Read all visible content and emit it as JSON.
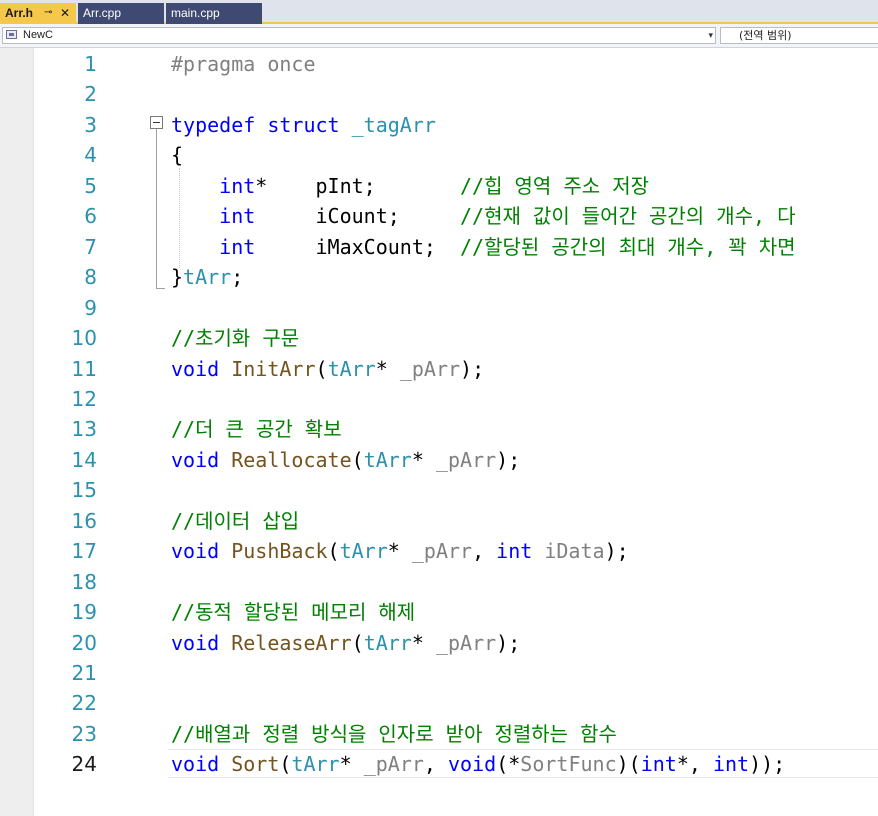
{
  "tabs": [
    {
      "label": "Arr.h",
      "pin": "⊸",
      "close": "✕"
    },
    {
      "label": "Arr.cpp"
    },
    {
      "label": "main.cpp"
    }
  ],
  "navbar": {
    "scope": "NewC",
    "member": "(전역 범위)",
    "dropdown_arrow": "▾"
  },
  "editor": {
    "current_line": 24,
    "lines": [
      {
        "n": "1",
        "tokens": [
          {
            "t": "#pragma once",
            "c": "pp"
          }
        ]
      },
      {
        "n": "2",
        "tokens": []
      },
      {
        "n": "3",
        "tokens": [
          {
            "t": "typedef",
            "c": "kw"
          },
          {
            "t": " "
          },
          {
            "t": "struct",
            "c": "kw"
          },
          {
            "t": " "
          },
          {
            "t": "_tagArr",
            "c": "ty"
          }
        ]
      },
      {
        "n": "4",
        "tokens": [
          {
            "t": "{"
          }
        ]
      },
      {
        "n": "5",
        "tokens": [
          {
            "t": "    "
          },
          {
            "t": "int",
            "c": "kw"
          },
          {
            "t": "*    pInt;       "
          },
          {
            "t": "//힙 영역 주소 저장",
            "c": "cm"
          }
        ]
      },
      {
        "n": "6",
        "tokens": [
          {
            "t": "    "
          },
          {
            "t": "int",
            "c": "kw"
          },
          {
            "t": "     iCount;     "
          },
          {
            "t": "//현재 값이 들어간 공간의 개수, 다",
            "c": "cm"
          }
        ]
      },
      {
        "n": "7",
        "tokens": [
          {
            "t": "    "
          },
          {
            "t": "int",
            "c": "kw"
          },
          {
            "t": "     iMaxCount;  "
          },
          {
            "t": "//할당된 공간의 최대 개수, 꽉 차면",
            "c": "cm"
          }
        ]
      },
      {
        "n": "8",
        "tokens": [
          {
            "t": "}"
          },
          {
            "t": "tArr",
            "c": "ty"
          },
          {
            "t": ";"
          }
        ]
      },
      {
        "n": "9",
        "tokens": []
      },
      {
        "n": "10",
        "tokens": [
          {
            "t": "//초기화 구문",
            "c": "cm"
          }
        ]
      },
      {
        "n": "11",
        "tokens": [
          {
            "t": "void",
            "c": "kw"
          },
          {
            "t": " "
          },
          {
            "t": "InitArr",
            "c": "fn"
          },
          {
            "t": "("
          },
          {
            "t": "tArr",
            "c": "ty"
          },
          {
            "t": "* "
          },
          {
            "t": "_pArr",
            "c": "pm"
          },
          {
            "t": ");"
          }
        ]
      },
      {
        "n": "12",
        "tokens": []
      },
      {
        "n": "13",
        "tokens": [
          {
            "t": "//더 큰 공간 확보",
            "c": "cm"
          }
        ]
      },
      {
        "n": "14",
        "tokens": [
          {
            "t": "void",
            "c": "kw"
          },
          {
            "t": " "
          },
          {
            "t": "Reallocate",
            "c": "fn"
          },
          {
            "t": "("
          },
          {
            "t": "tArr",
            "c": "ty"
          },
          {
            "t": "* "
          },
          {
            "t": "_pArr",
            "c": "pm"
          },
          {
            "t": ");"
          }
        ]
      },
      {
        "n": "15",
        "tokens": []
      },
      {
        "n": "16",
        "tokens": [
          {
            "t": "//데이터 삽입",
            "c": "cm"
          }
        ]
      },
      {
        "n": "17",
        "tokens": [
          {
            "t": "void",
            "c": "kw"
          },
          {
            "t": " "
          },
          {
            "t": "PushBack",
            "c": "fn"
          },
          {
            "t": "("
          },
          {
            "t": "tArr",
            "c": "ty"
          },
          {
            "t": "* "
          },
          {
            "t": "_pArr",
            "c": "pm"
          },
          {
            "t": ", "
          },
          {
            "t": "int",
            "c": "kw"
          },
          {
            "t": " "
          },
          {
            "t": "iData",
            "c": "pm"
          },
          {
            "t": ");"
          }
        ]
      },
      {
        "n": "18",
        "tokens": []
      },
      {
        "n": "19",
        "tokens": [
          {
            "t": "//동적 할당된 메모리 해제",
            "c": "cm"
          }
        ]
      },
      {
        "n": "20",
        "tokens": [
          {
            "t": "void",
            "c": "kw"
          },
          {
            "t": " "
          },
          {
            "t": "ReleaseArr",
            "c": "fn"
          },
          {
            "t": "("
          },
          {
            "t": "tArr",
            "c": "ty"
          },
          {
            "t": "* "
          },
          {
            "t": "_pArr",
            "c": "pm"
          },
          {
            "t": ");"
          }
        ]
      },
      {
        "n": "21",
        "tokens": []
      },
      {
        "n": "22",
        "tokens": []
      },
      {
        "n": "23",
        "tokens": [
          {
            "t": "//배열과 정렬 방식을 인자로 받아 정렬하는 함수",
            "c": "cm"
          }
        ]
      },
      {
        "n": "24",
        "tokens": [
          {
            "t": "void",
            "c": "kw"
          },
          {
            "t": " "
          },
          {
            "t": "Sort",
            "c": "fn"
          },
          {
            "t": "("
          },
          {
            "t": "tArr",
            "c": "ty"
          },
          {
            "t": "* "
          },
          {
            "t": "_pArr",
            "c": "pm"
          },
          {
            "t": ", "
          },
          {
            "t": "void",
            "c": "kw"
          },
          {
            "t": "(*"
          },
          {
            "t": "SortFunc",
            "c": "pm"
          },
          {
            "t": ")("
          },
          {
            "t": "int",
            "c": "kw"
          },
          {
            "t": "*, "
          },
          {
            "t": "int",
            "c": "kw"
          },
          {
            "t": "));"
          }
        ]
      }
    ]
  }
}
